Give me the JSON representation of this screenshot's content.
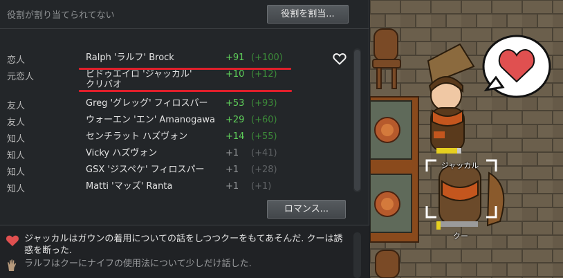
{
  "roles": {
    "status_text": "役割が割り当てられてない",
    "assign_button": "役割を割当..."
  },
  "relations": [
    {
      "type": "恋人",
      "name": "Ralph 'ラルフ' Brock",
      "opinion": "+91",
      "base": "(+100)"
    },
    {
      "type": "元恋人",
      "name": "ビドゥエイロ 'ジャッカル'\nクリバオ",
      "opinion": "+10",
      "base": "(+12)"
    },
    {
      "type": "友人",
      "name": "Greg 'グレッグ' フィロスパー",
      "opinion": "+53",
      "base": "(+93)"
    },
    {
      "type": "友人",
      "name": "ウォーエン 'エン' Amanogawa",
      "opinion": "+29",
      "base": "(+60)"
    },
    {
      "type": "知人",
      "name": "センチラット ハズヴォン",
      "opinion": "+14",
      "base": "(+55)"
    },
    {
      "type": "知人",
      "name": "Vicky ハズヴォン",
      "opinion": "+1",
      "base": "(+41)"
    },
    {
      "type": "知人",
      "name": "GSX 'ジスペケ' フィロスパー",
      "opinion": "+1",
      "base": "(+28)"
    },
    {
      "type": "知人",
      "name": "Matti 'マッズ' Ranta",
      "opinion": "+1",
      "base": "(+1)"
    }
  ],
  "romance_button": "ロマンス...",
  "log": [
    {
      "icon": "heart-icon",
      "text": "ジャッカルはガウンの着用についての話をしつつクーをもてあそんだ. クーは誘惑を断った."
    },
    {
      "icon": "hand-icon",
      "text": "ラルフはクーにナイフの使用法について少しだけ話した."
    }
  ],
  "world": {
    "pawn_label_1": "ジャッカル",
    "pawn_label_2": "クー"
  },
  "colors": {
    "underline": "#e01f2b",
    "opinion_positive": "#5fd05a",
    "heart": "#e05050"
  }
}
